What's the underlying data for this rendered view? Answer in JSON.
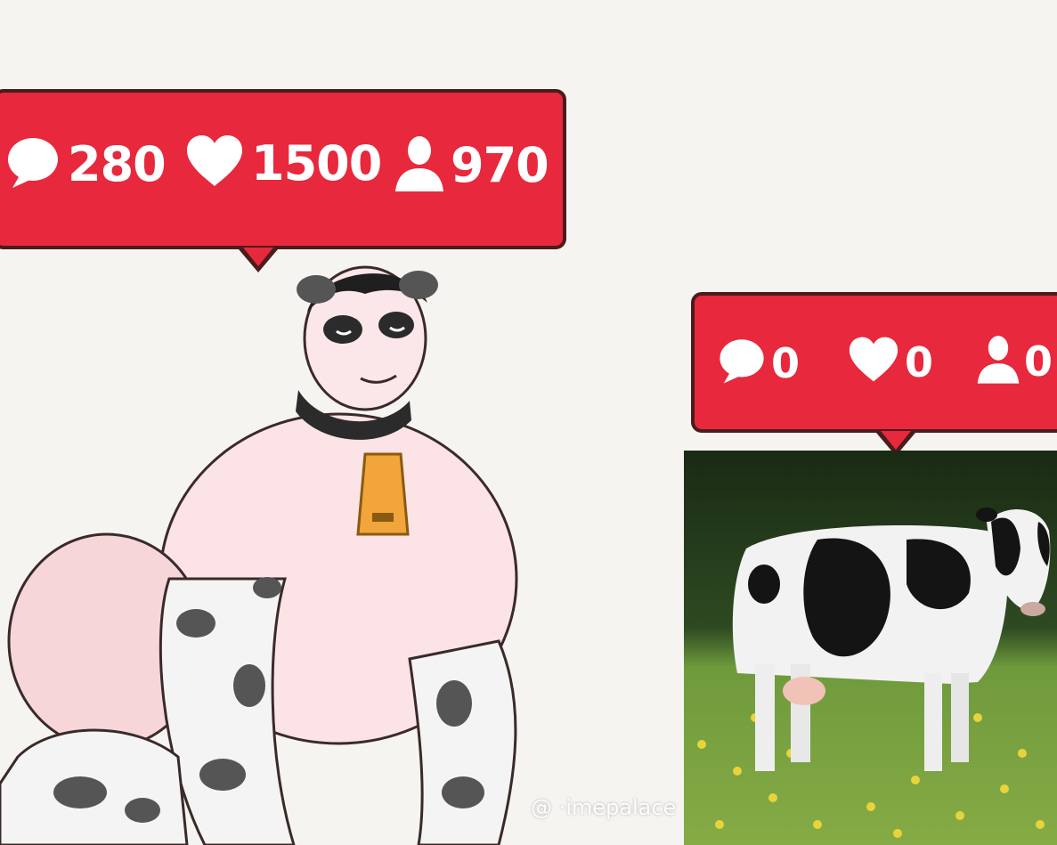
{
  "left_post": {
    "comments": "280",
    "likes": "1500",
    "followers": "970"
  },
  "right_post": {
    "comments": "0",
    "likes": "0",
    "followers": "0"
  },
  "watermark": "@ ·imepalace",
  "colors": {
    "bubble_red": "#e8283c",
    "bubble_border": "#4a1c1c",
    "background": "#f6f4f1"
  },
  "icons": [
    "comment-icon",
    "heart-icon",
    "person-icon"
  ]
}
